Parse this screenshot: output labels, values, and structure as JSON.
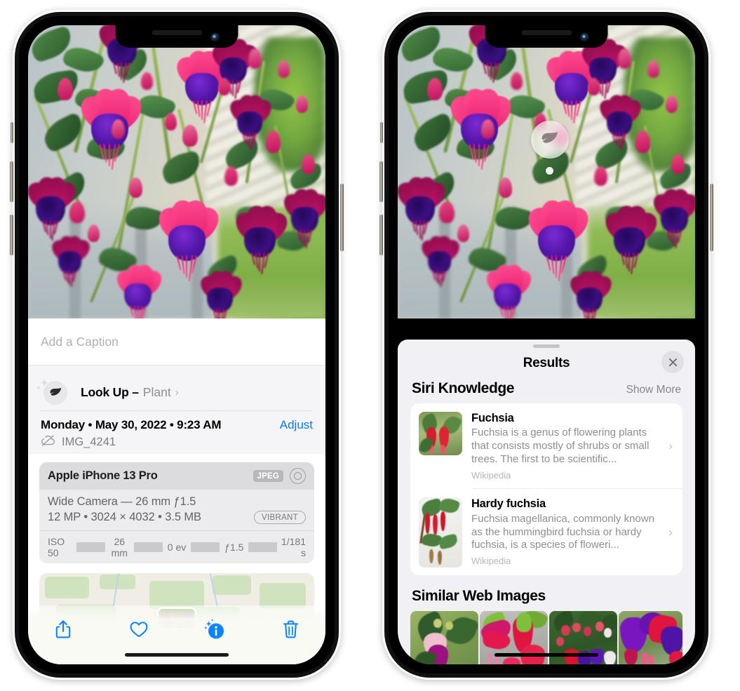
{
  "left_phone": {
    "caption": {
      "placeholder": "Add a Caption",
      "value": ""
    },
    "lookup": {
      "icon": "leaf-icon",
      "sparkle": "sparkles-icon",
      "title": "Look Up –",
      "subject": "Plant",
      "chevron": "›"
    },
    "meta": {
      "date": "Monday • May 30, 2022 • 9:23 AM",
      "adjust_label": "Adjust",
      "cloud_icon": "cloud-slash-icon",
      "filename": "IMG_4241"
    },
    "camera": {
      "device": "Apple iPhone 13 Pro",
      "format_badge": "JPEG",
      "aperture_icon": "aperture-icon",
      "lens_line": "Wide Camera — 26 mm ƒ1.5",
      "specs_line": "12 MP • 3024 × 4032 • 3.5 MB",
      "style_badge": "VIBRANT",
      "exif": [
        "ISO 50",
        "26 mm",
        "0 ev",
        "ƒ1.5",
        "1/181 s"
      ]
    },
    "toolbar": {
      "share_label": "share-icon",
      "favorite_label": "heart-icon",
      "info_label": "info-sparkle-icon",
      "delete_label": "trash-icon"
    }
  },
  "right_phone": {
    "badge": {
      "icon": "leaf-icon"
    },
    "sheet": {
      "title": "Results",
      "close_label": "✕"
    },
    "siri_knowledge": {
      "heading": "Siri Knowledge",
      "show_more": "Show More",
      "results": [
        {
          "title": "Fuchsia",
          "description": "Fuchsia is a genus of flowering plants that consists mostly of shrubs or small trees. The first to be scientific...",
          "source": "Wikipedia",
          "chevron": "›"
        },
        {
          "title": "Hardy fuchsia",
          "description": "Fuchsia magellanica, commonly known as the hummingbird fuchsia or hardy fuchsia, is a species of floweri...",
          "source": "Wikipedia",
          "chevron": "›"
        }
      ]
    },
    "similar_web_images": {
      "heading": "Similar Web Images",
      "thumbnails": [
        "fuchsia-thumb-1",
        "fuchsia-thumb-2",
        "fuchsia-thumb-3",
        "fuchsia-thumb-4"
      ]
    }
  },
  "colors": {
    "accent_blue": "#007aff",
    "sheet_bg": "#f1f1f5",
    "card_bg": "#ffffff",
    "secondary_text": "#8e8e93"
  }
}
